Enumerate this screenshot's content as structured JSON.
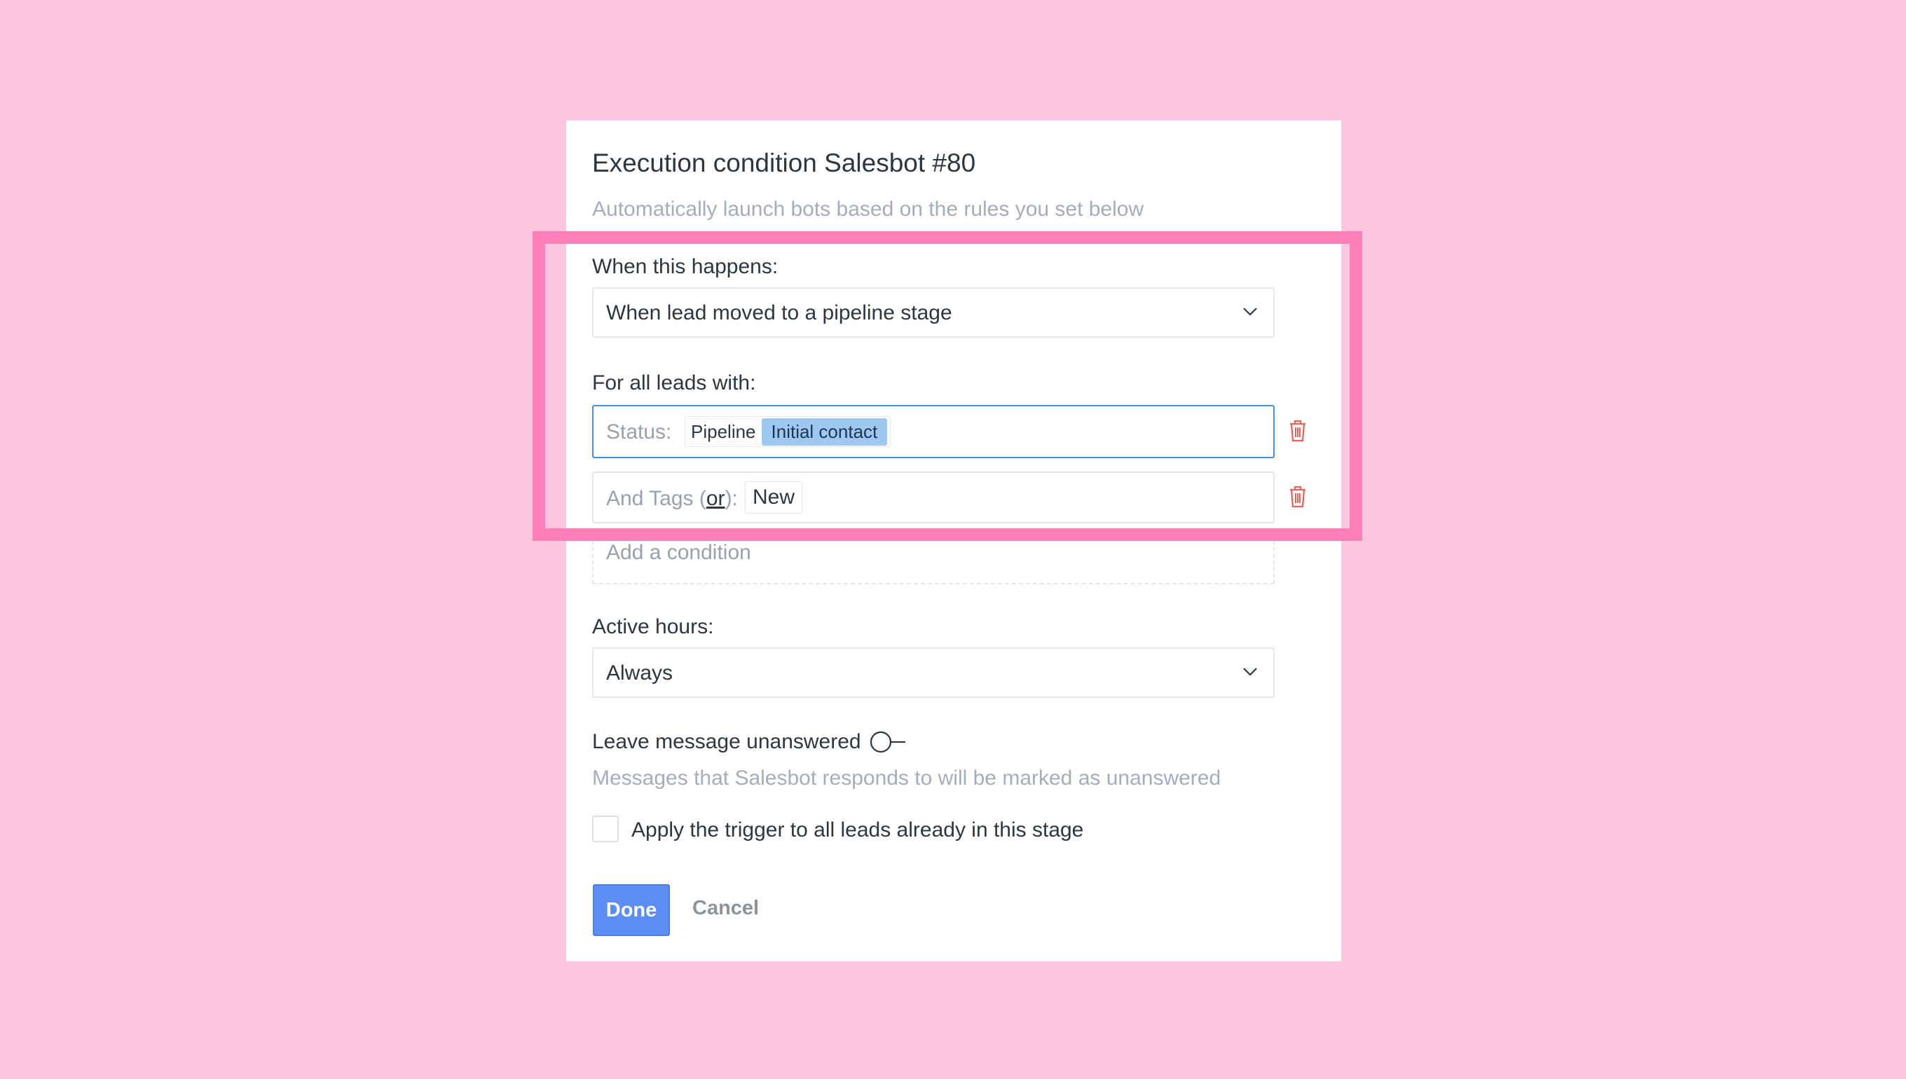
{
  "dialog": {
    "title": "Execution condition Salesbot #80",
    "subtitle": "Automatically launch bots based on the rules you set below"
  },
  "trigger": {
    "label": "When this happens:",
    "value": "When lead moved to a pipeline stage",
    "icon": "chevron-down-icon"
  },
  "filters": {
    "label": "For all leads with:",
    "status": {
      "prefix": "Status:",
      "pipeline": "Pipeline",
      "stage": "Initial contact",
      "stage_color": "#9ec7f1"
    },
    "tags": {
      "prefix": "And Tags (",
      "or": "or",
      "suffix": "):",
      "value": "New"
    },
    "delete_icon": "trash-icon",
    "delete_color": "#e8605a",
    "add_condition": "Add a condition"
  },
  "active_hours": {
    "label": "Active hours:",
    "value": "Always"
  },
  "unanswered": {
    "label": "Leave message unanswered",
    "toggle_on": false,
    "hint": "Messages that Salesbot responds to will be marked as unanswered"
  },
  "apply_all": {
    "label": "Apply the trigger to all leads already in this stage",
    "checked": false
  },
  "actions": {
    "done": "Done",
    "cancel": "Cancel",
    "primary_color": "#5b8ef0"
  },
  "highlight_color": "#ff7fb8",
  "background_color": "#ffc8e0"
}
